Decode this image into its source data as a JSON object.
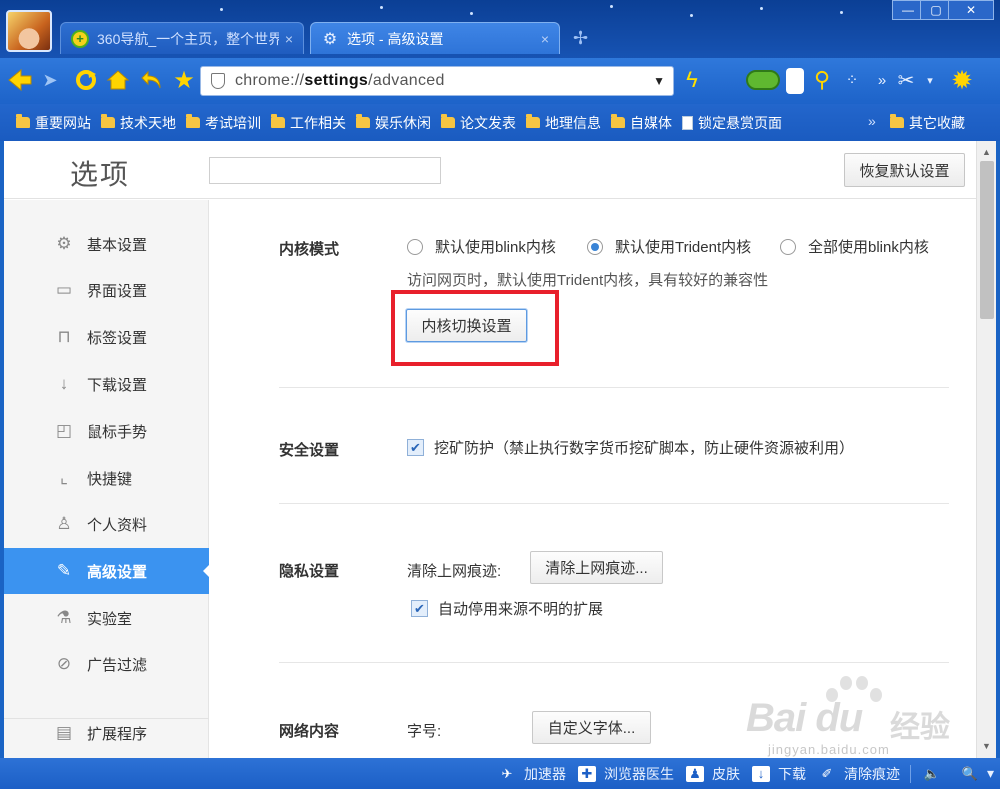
{
  "browser": {
    "tabs": [
      {
        "title": "360导航_一个主页，整个世界",
        "icon": "360-nav-icon",
        "active": false
      },
      {
        "title": "选项 - 高级设置",
        "icon": "settings-gear-icon",
        "active": true
      }
    ],
    "close_glyph": "×",
    "new_tab_glyph": "✢",
    "window_controls": {
      "minimize": "—",
      "maximize": "▢",
      "close": "✕"
    },
    "address_bar": {
      "scheme": "chrome://",
      "host": "settings",
      "path": "/advanced"
    },
    "toolbar_glyphs": {
      "dropdown": "▼",
      "more": "»",
      "scissor": "✂",
      "scissor_dd": "▾",
      "gear": "✹",
      "bolt": "ϟ",
      "magnifier": "⚲",
      "qr": "⁘"
    },
    "bookmarks": [
      {
        "label": "重要网站",
        "type": "folder"
      },
      {
        "label": "技术天地",
        "type": "folder"
      },
      {
        "label": "考试培训",
        "type": "folder"
      },
      {
        "label": "工作相关",
        "type": "folder"
      },
      {
        "label": "娱乐休闲",
        "type": "folder"
      },
      {
        "label": "论文发表",
        "type": "folder"
      },
      {
        "label": "地理信息",
        "type": "folder"
      },
      {
        "label": "自媒体",
        "type": "folder"
      },
      {
        "label": "锁定悬赏页面",
        "type": "page"
      }
    ],
    "bookmarks_overflow": "»",
    "other_bookmarks": "其它收藏"
  },
  "settings": {
    "title": "选项",
    "search_placeholder": "",
    "restore_button": "恢复默认设置",
    "nav": [
      {
        "label": "基本设置",
        "icon": "gear-icon",
        "glyph": "⚙",
        "active": false
      },
      {
        "label": "界面设置",
        "icon": "window-icon",
        "glyph": "▭",
        "active": false
      },
      {
        "label": "标签设置",
        "icon": "tab-icon",
        "glyph": "⊓",
        "active": false
      },
      {
        "label": "下载设置",
        "icon": "download-icon",
        "glyph": "↓",
        "active": false
      },
      {
        "label": "鼠标手势",
        "icon": "mouse-icon",
        "glyph": "◰",
        "active": false
      },
      {
        "label": "快捷键",
        "icon": "shortcut-icon",
        "glyph": "⌞",
        "active": false
      },
      {
        "label": "个人资料",
        "icon": "user-icon",
        "glyph": "♙",
        "active": false
      },
      {
        "label": "高级设置",
        "icon": "wrench-icon",
        "glyph": "✎",
        "active": true
      },
      {
        "label": "实验室",
        "icon": "flask-icon",
        "glyph": "⚗",
        "active": false
      },
      {
        "label": "广告过滤",
        "icon": "block-icon",
        "glyph": "⊘",
        "active": false
      },
      {
        "label": "扩展程序",
        "icon": "extension-icon",
        "glyph": "▤",
        "active": false
      }
    ],
    "kernel": {
      "label": "内核模式",
      "options": [
        {
          "label": "默认使用blink内核",
          "selected": false
        },
        {
          "label": "默认使用Trident内核",
          "selected": true
        },
        {
          "label": "全部使用blink内核",
          "selected": false
        }
      ],
      "description": "访问网页时，默认使用Trident内核，具有较好的兼容性",
      "switch_button": "内核切换设置",
      "highlight_color": "#e8202b"
    },
    "security": {
      "label": "安全设置",
      "mining_protection": {
        "label": "挖矿防护（禁止执行数字货币挖矿脚本，防止硬件资源被利用）",
        "checked": true
      }
    },
    "privacy": {
      "label": "隐私设置",
      "clear_label": "清除上网痕迹:",
      "clear_button": "清除上网痕迹...",
      "auto_disable": {
        "label": "自动停用来源不明的扩展",
        "checked": true
      }
    },
    "web_content": {
      "label": "网络内容",
      "font_label": "字号:",
      "custom_font_button": "自定义字体..."
    },
    "check_glyph": "✔"
  },
  "statusbar": [
    {
      "label": "加速器",
      "icon": "rocket-icon",
      "glyph": "✈"
    },
    {
      "label": "浏览器医生",
      "icon": "doctor-icon",
      "glyph": "✚"
    },
    {
      "label": "皮肤",
      "icon": "skin-icon",
      "glyph": "♟"
    },
    {
      "label": "下载",
      "icon": "download-icon",
      "glyph": "↓"
    },
    {
      "label": "清除痕迹",
      "icon": "broom-icon",
      "glyph": "✐"
    }
  ],
  "statusbar_extra": {
    "volume": "🔈",
    "zoom": "🔍",
    "zoom_dd": "▾"
  },
  "watermark": {
    "brand": "Bai du",
    "brand_cn": "经验",
    "url": "jingyan.baidu.com"
  },
  "colors": {
    "accent": "#3b93f0",
    "chrome_blue": "#1d63c9",
    "highlight": "#e8202b"
  }
}
